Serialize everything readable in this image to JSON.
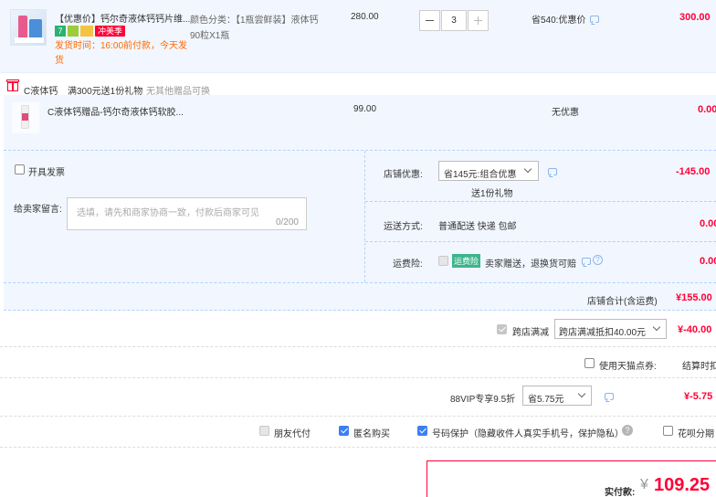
{
  "item1": {
    "title": "【优惠价】钙尔奇液体钙钙片维...",
    "badges": [
      "7",
      "冲美季"
    ],
    "ship_time": "发货时间：16:00前付款，今天发货",
    "spec_line1": "颜色分类：【1瓶尝鲜装】液体钙",
    "spec_line2": "90粒X1瓶",
    "price": "280.00",
    "qty": "3",
    "discount": "省540:优惠价",
    "subtotal": "300.00"
  },
  "gift_section": {
    "shop_tag": "C液体钙",
    "promo": "满300元送1份礼物",
    "note": "无其他赠品可换"
  },
  "item2": {
    "title": "C液体钙赠品-钙尔奇液体钙软胶...",
    "price": "99.00",
    "discount": "无优惠",
    "subtotal": "0.00"
  },
  "order_opts": {
    "invoice_label": "开具发票",
    "message_label": "给卖家留言:",
    "message_placeholder": "选填，请先和商家协商一致，付款后商家可见",
    "message_counter": "0/200",
    "store_discount_label": "店铺优惠:",
    "store_discount_value": "省145元:组合优惠",
    "store_discount_sub": "送1份礼物",
    "store_discount_amount": "-145.00",
    "shipping_label": "运送方式:",
    "shipping_value": "普通配送 快递 包邮",
    "shipping_amount": "0.00",
    "insurance_label": "运费险:",
    "insurance_tag": "运费险",
    "insurance_text": "卖家赠送，退换货可赔",
    "insurance_amount": "0.00",
    "store_total_label": "店铺合计(含运费)",
    "store_total_value": "¥155.00"
  },
  "cross_store": {
    "label": "跨店满减",
    "select": "跨店满减抵扣40.00元",
    "amount": "¥-40.00"
  },
  "points": {
    "label": "使用天猫点券:",
    "right": "结算时扣"
  },
  "vip": {
    "label": "88VIP专享9.5折",
    "select": "省5.75元",
    "amount": "¥-5.75"
  },
  "footer_opts": {
    "friend_pay": "朋友代付",
    "anonymous": "匿名购买",
    "privacy": "号码保护（隐藏收件人真实手机号，保护隐私）",
    "huabei": "花呗分期"
  },
  "total": {
    "label": "实付款:",
    "currency": "¥",
    "value": "109.25"
  }
}
